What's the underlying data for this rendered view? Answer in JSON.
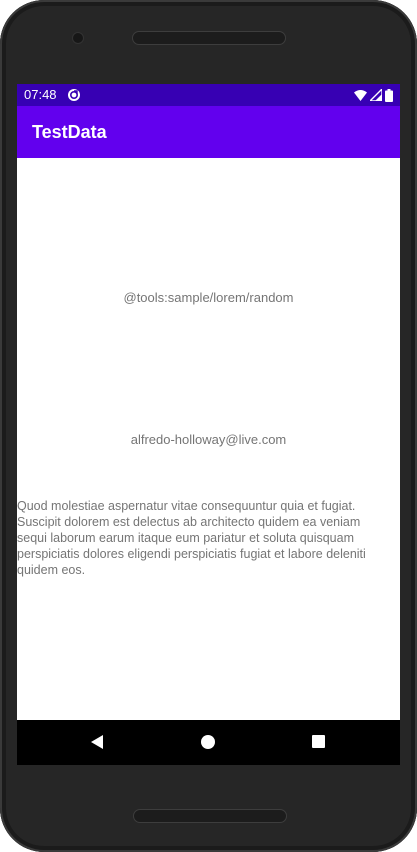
{
  "status_bar": {
    "time": "07:48",
    "icons": [
      "sync-icon",
      "wifi-icon",
      "signal-icon",
      "battery-icon"
    ]
  },
  "app_bar": {
    "title": "TestData",
    "color": "#6200ee"
  },
  "content": {
    "sample_text": "@tools:sample/lorem/random",
    "email": "alfredo-holloway@live.com",
    "lorem_paragraph": "Quod molestiae aspernatur vitae consequuntur quia et fugiat. Suscipit dolorem est delectus ab architecto quidem ea veniam sequi laborum earum itaque eum pariatur et soluta quisquam perspiciatis dolores eligendi perspiciatis fugiat et labore deleniti quidem eos."
  },
  "nav_bar": {
    "buttons": [
      "back-icon",
      "home-icon",
      "recents-icon"
    ]
  },
  "colors": {
    "status_bar": "#3700b3",
    "app_bar": "#6200ee",
    "text": "#757575"
  }
}
